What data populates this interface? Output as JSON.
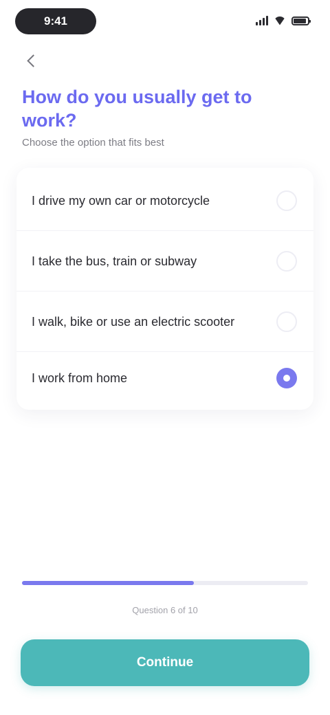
{
  "status_bar": {
    "time": "9:41",
    "battery_level": 0.9
  },
  "question": {
    "title": "How do you usually get to work?",
    "subtitle": "Choose the option that fits best"
  },
  "options": [
    {
      "label": "I drive my own car or motorcycle",
      "selected": false
    },
    {
      "label": "I take the bus, train or subway",
      "selected": false
    },
    {
      "label": "I walk, bike or use an electric scooter",
      "selected": false
    },
    {
      "label": "I work from home",
      "selected": true
    }
  ],
  "progress": {
    "fraction": 0.6,
    "label": "Question 6 of 10"
  },
  "continue_label": "Continue",
  "colors": {
    "accent": "#7a79ee",
    "button": "#4cb8b8"
  },
  "icons": {
    "back": "chevron-left-icon",
    "signal": "signal-icon",
    "wifi": "wifi-icon",
    "battery": "battery-icon",
    "radio_selected": "radio-selected-icon"
  }
}
